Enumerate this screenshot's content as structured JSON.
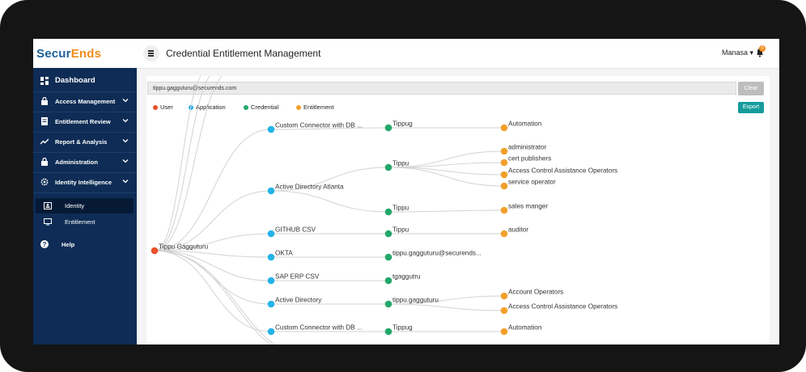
{
  "app": {
    "logo_part1": "Secur",
    "logo_part2": "Ends",
    "page_title": "Credential Entitlement Management",
    "user_name": "Manasa",
    "notification_count": "0"
  },
  "sidebar": {
    "items": [
      {
        "label": "Dashboard",
        "icon": "dashboard-icon"
      },
      {
        "label": "Access Management",
        "icon": "lock-icon"
      },
      {
        "label": "Entitlement Review",
        "icon": "document-icon"
      },
      {
        "label": "Report & Analysis",
        "icon": "trend-chart-icon"
      },
      {
        "label": "Administration",
        "icon": "lock-icon"
      },
      {
        "label": "Identity Intelligence",
        "icon": "gear-icon"
      }
    ],
    "subitems": [
      {
        "label": "Identity",
        "icon": "id-card-icon",
        "active": true
      },
      {
        "label": "Entitlement",
        "icon": "monitor-icon",
        "active": false
      }
    ],
    "help_label": "Help"
  },
  "search": {
    "value": "tippu.gagguturu@securends.com",
    "clear_label": "Clear",
    "export_label": "Export"
  },
  "legend": [
    {
      "label": "User",
      "color": "#e8502b"
    },
    {
      "label": "Application",
      "color": "#23b3e8"
    },
    {
      "label": "Credential",
      "color": "#23a86b"
    },
    {
      "label": "Entitlement",
      "color": "#f3a02c"
    }
  ],
  "graph": {
    "user": "Tippu Gagguturu",
    "applications": [
      {
        "label": "Custom Connector with DB ..."
      },
      {
        "label": "Active Directory Atlanta"
      },
      {
        "label": "GITHUB CSV"
      },
      {
        "label": "OKTA"
      },
      {
        "label": "SAP ERP CSV"
      },
      {
        "label": "Active Directory"
      },
      {
        "label": "Custom Connector with DB ..."
      }
    ],
    "credentials": [
      {
        "label": "Tippug",
        "app": 0
      },
      {
        "label": "Tippu",
        "app": 1
      },
      {
        "label": "Tippu",
        "app": 1
      },
      {
        "label": "Tippu",
        "app": 2
      },
      {
        "label": "tippu.gagguturu@securends...",
        "app": 3
      },
      {
        "label": "tgaggutru",
        "app": 4
      },
      {
        "label": "tippu.gagguturu",
        "app": 5
      },
      {
        "label": "Tippug",
        "app": 6
      }
    ],
    "entitlements": [
      {
        "label": "Automation",
        "cred": 0
      },
      {
        "label": "administrator",
        "cred": 1
      },
      {
        "label": "cert publishers",
        "cred": 1
      },
      {
        "label": "Access Control Assistance Operators",
        "cred": 1
      },
      {
        "label": "service operator",
        "cred": 1
      },
      {
        "label": "sales manger",
        "cred": 2
      },
      {
        "label": "auditor",
        "cred": 3
      },
      {
        "label": "Account Operators",
        "cred": 6
      },
      {
        "label": "Access Control Assistance Operators",
        "cred": 6
      },
      {
        "label": "Automation",
        "cred": 7
      }
    ]
  }
}
